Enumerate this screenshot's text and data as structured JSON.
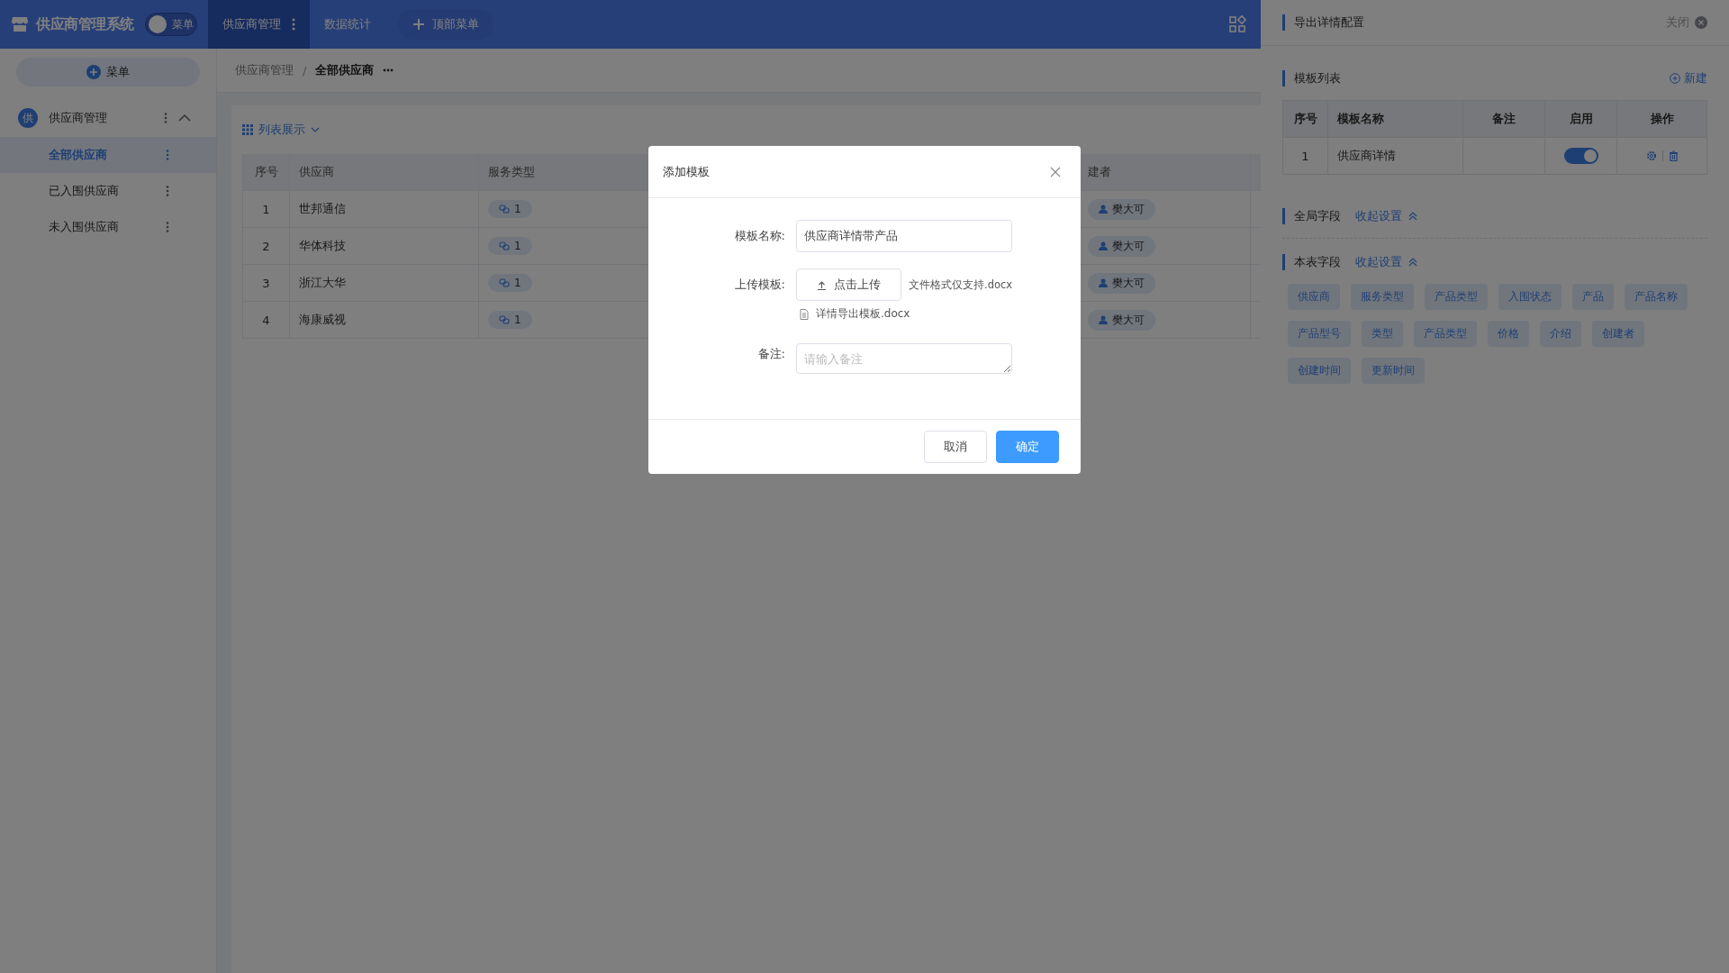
{
  "app": {
    "logo_text": "供应商管理系统",
    "menu_toggle": {
      "label": "菜单",
      "on": false
    }
  },
  "top_nav": [
    {
      "label": "供应商管理",
      "selected": true,
      "has_more": true
    },
    {
      "label": "数据统计",
      "selected": false,
      "has_more": false
    }
  ],
  "top_menu_button": "顶部菜单",
  "sidebar": {
    "add_button": "菜单",
    "group": {
      "badge": "供",
      "label": "供应商管理",
      "expanded": true,
      "children": [
        {
          "label": "全部供应商",
          "selected": true
        },
        {
          "label": "已入围供应商",
          "selected": false
        },
        {
          "label": "未入围供应商",
          "selected": false
        }
      ]
    }
  },
  "breadcrumb": {
    "items": [
      "供应商管理",
      "全部供应商"
    ],
    "separator": "/"
  },
  "view_switch": {
    "label": "列表展示",
    "expanded": false
  },
  "table": {
    "columns": [
      "序号",
      "供应商",
      "服务类型",
      "建者"
    ],
    "rows": [
      {
        "index": "1",
        "supplier": "世邦通信",
        "service_count": "1",
        "creator": "樊大可"
      },
      {
        "index": "2",
        "supplier": "华体科技",
        "service_count": "1",
        "creator": "樊大可"
      },
      {
        "index": "3",
        "supplier": "浙江大华",
        "service_count": "1",
        "creator": "樊大可"
      },
      {
        "index": "4",
        "supplier": "海康威视",
        "service_count": "1",
        "creator": "樊大可"
      }
    ]
  },
  "drawer": {
    "title": "导出详情配置",
    "close_label": "关闭",
    "templates": {
      "title": "模板列表",
      "new_label": "新建",
      "columns": [
        "序号",
        "模板名称",
        "备注",
        "启用",
        "操作"
      ],
      "rows": [
        {
          "index": "1",
          "name": "供应商详情",
          "enabled": true
        }
      ]
    },
    "global_fields": {
      "title": "全局字段",
      "toggle": "收起设置",
      "expanded": true
    },
    "table_fields": {
      "title": "本表字段",
      "toggle": "收起设置",
      "expanded": true,
      "fields": [
        "供应商",
        "服务类型",
        "产品类型",
        "入围状态",
        "产品",
        "产品名称",
        "产品型号",
        "类型",
        "产品类型",
        "价格",
        "介绍",
        "创建者",
        "创建时间",
        "更新时间"
      ]
    }
  },
  "modal": {
    "title": "添加模板",
    "fields": [
      {
        "kind": "text",
        "label": "模板名称:",
        "value": "供应商详情带产品"
      },
      {
        "kind": "upload",
        "label": "上传模板:",
        "button": "点击上传",
        "hint": "文件格式仅支持.docx",
        "files": [
          "详情导出模板.docx"
        ]
      },
      {
        "kind": "textarea",
        "label": "备注:",
        "placeholder": "请输入备注"
      }
    ],
    "buttons": [
      {
        "label": "取消",
        "primary": false
      },
      {
        "label": "确定",
        "primary": true
      }
    ]
  }
}
